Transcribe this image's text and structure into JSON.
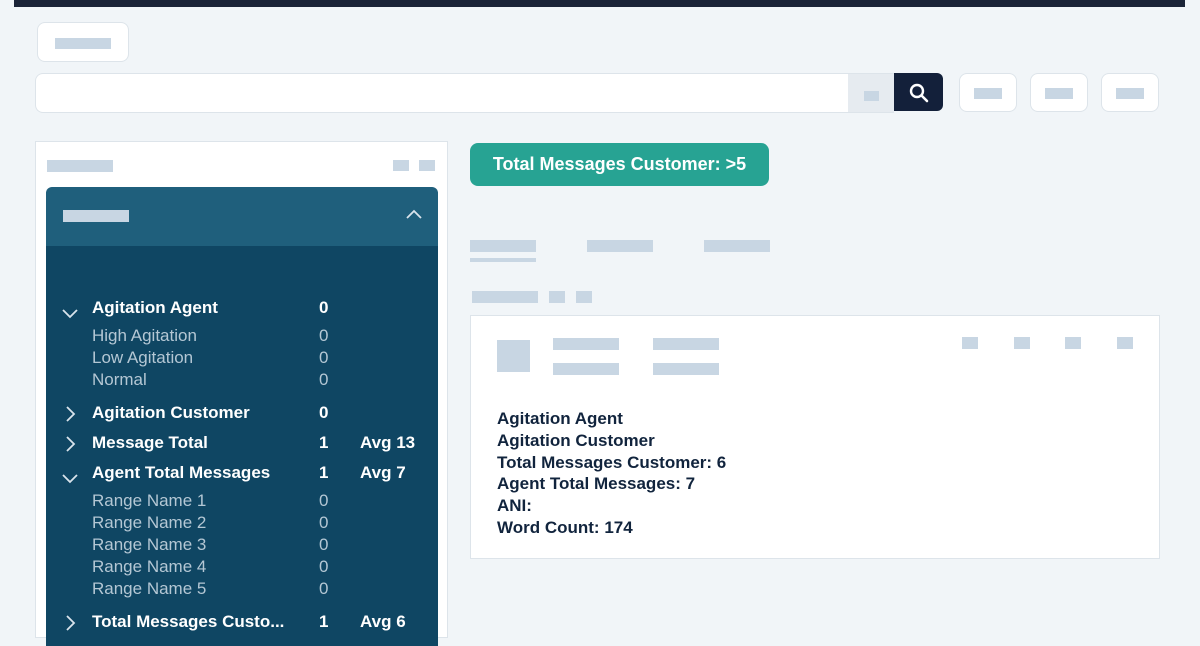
{
  "filter_chip": {
    "label": "Total Messages Customer: >5"
  },
  "categories": [
    {
      "name": "Agitation Agent",
      "count": "0",
      "avg": "",
      "expanded": true,
      "items": [
        {
          "name": "High Agitation",
          "count": "0"
        },
        {
          "name": "Low Agitation",
          "count": "0"
        },
        {
          "name": "Normal",
          "count": "0"
        }
      ]
    },
    {
      "name": "Agitation Customer",
      "count": "0",
      "avg": "",
      "expanded": false
    },
    {
      "name": "Message Total",
      "count": "1",
      "avg": "Avg 13",
      "expanded": false
    },
    {
      "name": "Agent Total Messages",
      "count": "1",
      "avg": "Avg 7",
      "expanded": true,
      "items": [
        {
          "name": "Range Name 1",
          "count": "0"
        },
        {
          "name": "Range Name 2",
          "count": "0"
        },
        {
          "name": "Range Name 3",
          "count": "0"
        },
        {
          "name": "Range Name 4",
          "count": "0"
        },
        {
          "name": "Range Name 5",
          "count": "0"
        }
      ]
    },
    {
      "name": "Total Messages Custo...",
      "count": "1",
      "avg": "Avg 6",
      "expanded": false
    }
  ],
  "result": {
    "lines": [
      "Agitation Agent",
      "Agitation Customer",
      "Total Messages Customer: 6",
      "Agent Total Messages: 7",
      "ANI:",
      "Word Count: 174"
    ]
  },
  "icons": {
    "search": "search-icon",
    "collapse": "chevron-up-icon",
    "expanded": "chevron-down-icon",
    "collapsed": "chevron-right-icon"
  },
  "colors": {
    "accent_teal": "#27a393",
    "panel_dark": "#0f4663",
    "panel_header": "#1f5f7c",
    "topbar": "#1b2438"
  }
}
